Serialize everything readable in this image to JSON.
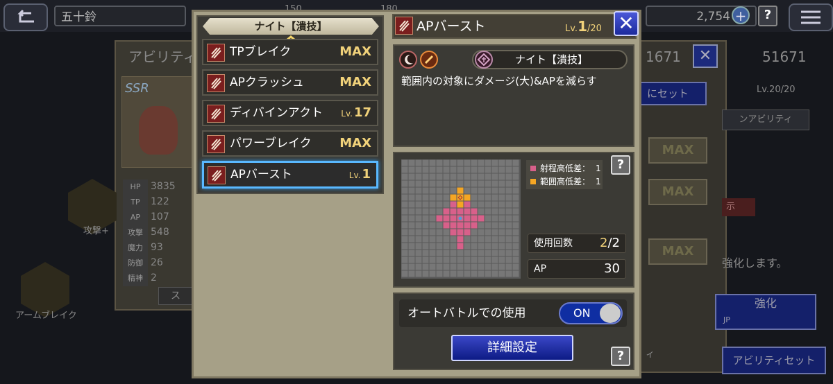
{
  "background": {
    "player_name": "五十鈴",
    "gems": "2,754",
    "top_partial_1": "150",
    "top_partial_2": "180",
    "left_panel_title": "アビリティ",
    "rarity": "SSR",
    "stats": [
      {
        "label": "HP",
        "value": "3835"
      },
      {
        "label": "TP",
        "value": "122"
      },
      {
        "label": "AP",
        "value": "107"
      },
      {
        "label": "攻撃",
        "value": "548"
      },
      {
        "label": "魔力",
        "value": "93"
      },
      {
        "label": "防御",
        "value": "26"
      },
      {
        "label": "精神",
        "value": "2"
      }
    ],
    "skill_labels": [
      "攻撃+",
      "アームブレイク"
    ],
    "left_partial_btn": "ス",
    "right_numbers": [
      "1671",
      "51671"
    ],
    "right_set_btn": "にセット",
    "right_level": "Lv.20/20",
    "right_tab": "ンアビリティ",
    "right_max": [
      "MAX",
      "MAX",
      "MAX"
    ],
    "right_tag": "示",
    "right_text": "強化します。",
    "right_enhance_btn": "強化",
    "right_jp": "JP",
    "right_bottom_text": "ィ",
    "right_bottom_btn": "アビリティセット"
  },
  "list": {
    "header": "ナイト【潰技】",
    "items": [
      {
        "name": "TPブレイク",
        "level_prefix": "",
        "level": "MAX"
      },
      {
        "name": "APクラッシュ",
        "level_prefix": "",
        "level": "MAX"
      },
      {
        "name": "ディバインアクト",
        "level_prefix": "Lv.",
        "level": "17"
      },
      {
        "name": "パワーブレイク",
        "level_prefix": "",
        "level": "MAX"
      },
      {
        "name": "APバースト",
        "level_prefix": "Lv.",
        "level": "1"
      }
    ]
  },
  "detail": {
    "title": "APバースト",
    "lv_prefix": "Lv.",
    "lv_current": "1",
    "lv_max": "/20",
    "close_label": "✕",
    "job": "ナイト【潰技】",
    "description": "範囲内の対象にダメージ(大)&APを減らす",
    "legend_range": "射程高低差：",
    "legend_range_val": "1",
    "legend_area": "範囲高低差：",
    "legend_area_val": "1",
    "uses_label": "使用回数",
    "uses_current": "2",
    "uses_max": "/2",
    "ap_label": "AP",
    "ap_value": "30",
    "auto_label": "オートバトルでの使用",
    "toggle_label": "ON",
    "detail_btn": "詳細設定",
    "help": "?"
  },
  "colors": {
    "range_tile": "#d8608a",
    "area_tile": "#f5a623",
    "center_tile": "#4f9fd8",
    "accent_blue": "#1c2a9c",
    "level_gold": "#f1d27a"
  }
}
